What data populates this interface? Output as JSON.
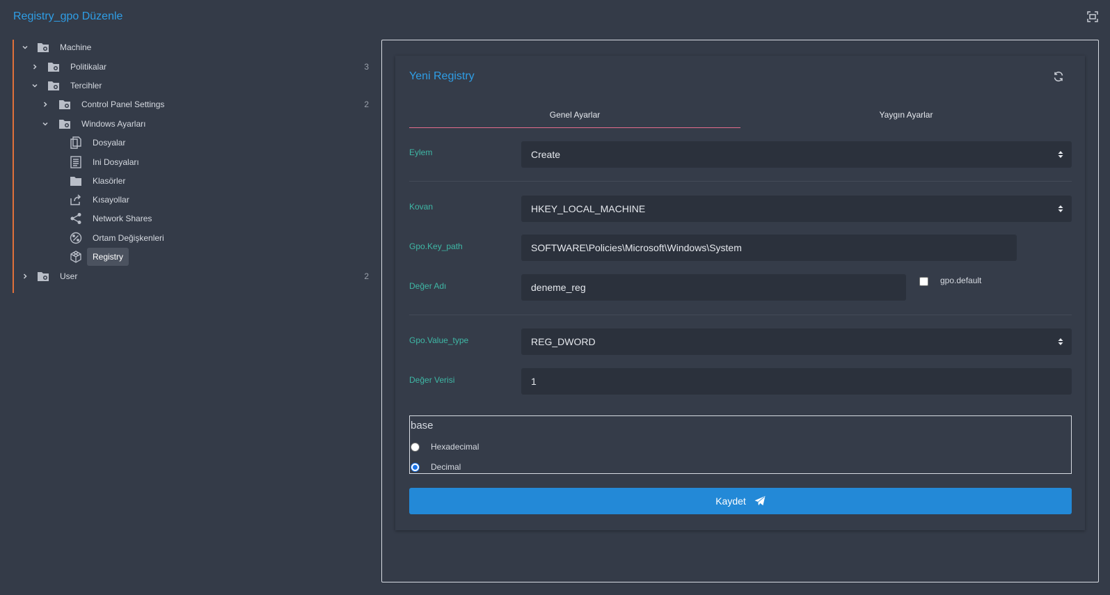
{
  "page": {
    "title": "Registry_gpo Düzenle"
  },
  "tree": {
    "machine": {
      "label": "Machine"
    },
    "policies": {
      "label": "Politikalar",
      "count": "3"
    },
    "preferences": {
      "label": "Tercihler"
    },
    "control_panel": {
      "label": "Control Panel Settings",
      "count": "2"
    },
    "windows_settings": {
      "label": "Windows Ayarları"
    },
    "files": {
      "label": "Dosyalar"
    },
    "ini_files": {
      "label": "Ini Dosyaları"
    },
    "folders": {
      "label": "Klasörler"
    },
    "shortcuts": {
      "label": "Kısayollar"
    },
    "network_shares": {
      "label": "Network Shares"
    },
    "env_vars": {
      "label": "Ortam Değişkenleri"
    },
    "registry": {
      "label": "Registry"
    },
    "user": {
      "label": "User",
      "count": "2"
    }
  },
  "card": {
    "title": "Yeni Registry",
    "tabs": {
      "general": "Genel Ayarlar",
      "common": "Yaygın Ayarlar"
    }
  },
  "form": {
    "action": {
      "label": "Eylem",
      "value": "Create"
    },
    "hive": {
      "label": "Kovan",
      "value": "HKEY_LOCAL_MACHINE"
    },
    "key_path": {
      "label": "Gpo.Key_path",
      "value": "SOFTWARE\\Policies\\Microsoft\\Windows\\System"
    },
    "value_name": {
      "label": "Değer Adı",
      "value": "deneme_reg"
    },
    "default_checkbox": {
      "label": "gpo.default",
      "checked": false
    },
    "value_type": {
      "label": "Gpo.Value_type",
      "value": "REG_DWORD"
    },
    "value_data": {
      "label": "Değer Verisi",
      "value": "1"
    },
    "base": {
      "legend": "base",
      "options": [
        "Hexadecimal",
        "Decimal"
      ],
      "selected": "Decimal"
    },
    "save_label": "Kaydet"
  },
  "colors": {
    "accent": "#2f9ee6",
    "label_teal": "#3fb8a6",
    "button": "#2389d7",
    "tree_rail": "#e0703a",
    "tab_underline": "#e56d8c"
  },
  "icons": {
    "folder_cog": "folder-settings-icon",
    "files": "files-icon",
    "ini": "document-list-icon",
    "folder": "folder-icon",
    "shortcut": "share-arrow-icon",
    "network": "share-nodes-icon",
    "env": "percent-icon",
    "registry": "cube-icon"
  }
}
